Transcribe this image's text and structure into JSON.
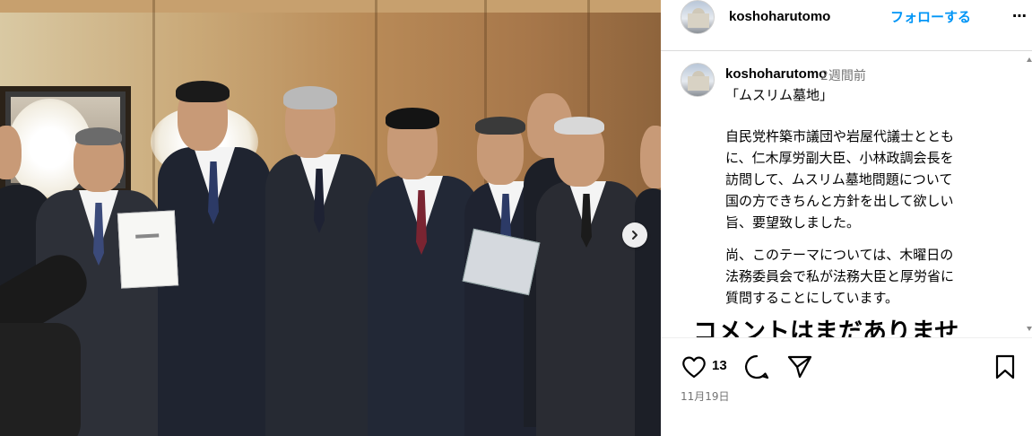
{
  "post": {
    "author": "koshoharutomo",
    "follow_label": "フォローする",
    "more_label": "⋯",
    "caption": {
      "author": "koshoharutomo",
      "time_ago": "2週間前",
      "title": "「ムスリム墓地」",
      "lines_para1": [
        "自民党杵築市議団や岩屋代議士ととも",
        "に、仁木厚労副大臣、小林政調会長を",
        "訪問して、ムスリム墓地問題について",
        "国の方できちんと方針を出して欲しい",
        "旨、要望致しました。"
      ],
      "lines_para2": [
        "尚、このテーマについては、木曜日の",
        "法務委員会で私が法務大臣と厚労省に",
        "質問することにしています。"
      ]
    },
    "comments_empty_text": "コメントはまだありませ",
    "likes": "13",
    "date": "11月19日"
  },
  "colors": {
    "link_blue": "#0095f6",
    "muted": "#737373",
    "border": "#dbdbdb"
  },
  "icons": {
    "like": "heart-icon",
    "comment": "comment-bubble-icon",
    "share": "paper-plane-icon",
    "save": "bookmark-icon",
    "next": "chevron-right-icon"
  }
}
